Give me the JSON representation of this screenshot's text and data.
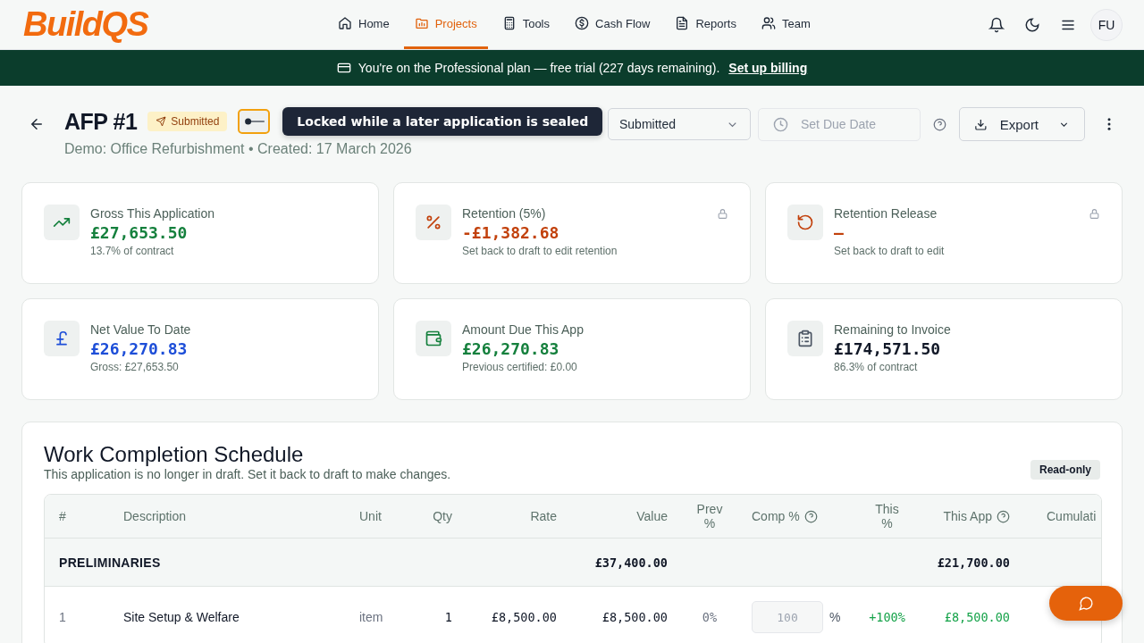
{
  "nav": {
    "logo": "BuildQS",
    "items": [
      {
        "label": "Home",
        "selected": false
      },
      {
        "label": "Projects",
        "selected": true
      },
      {
        "label": "Tools",
        "selected": false
      },
      {
        "label": "Cash Flow",
        "selected": false
      },
      {
        "label": "Reports",
        "selected": false
      },
      {
        "label": "Team",
        "selected": false
      }
    ],
    "avatar": "FU"
  },
  "banner": {
    "text": "You're on the Professional plan — free trial (227 days remaining).",
    "link": "Set up billing"
  },
  "header": {
    "title": "AFP #1",
    "status_badge": "Submitted",
    "tooltip": "Locked while a later application is sealed",
    "subtitle": "Demo: Office Refurbishment • Created: 17 March 2026",
    "status_select": "Submitted",
    "due_date": {
      "label": "Set Due Date",
      "disabled": true
    },
    "export": "Export"
  },
  "cards": [
    {
      "label": "Gross This Application",
      "value": "£27,653.50",
      "color": "#15803d",
      "note": "13.7% of contract",
      "locked": false
    },
    {
      "label": "Retention (5%)",
      "value": "-£1,382.68",
      "color": "#c2410c",
      "note": "Set back to draft to edit retention",
      "locked": true
    },
    {
      "label": "Retention Release",
      "value": "—",
      "color": "#c2410c",
      "note": "Set back to draft to edit",
      "locked": true
    },
    {
      "label": "Net Value To Date",
      "value": "£26,270.83",
      "color": "#1d4ed8",
      "note": "Gross: £27,653.50",
      "locked": false
    },
    {
      "label": "Amount Due This App",
      "value": "£26,270.83",
      "color": "#15803d",
      "note": "Previous certified: £0.00",
      "locked": false
    },
    {
      "label": "Remaining to Invoice",
      "value": "£174,571.50",
      "color": "#111827",
      "note": "86.3% of contract",
      "locked": false
    }
  ],
  "schedule": {
    "title": "Work Completion Schedule",
    "subtitle": "This application is no longer in draft. Set it back to draft to make changes.",
    "badge": "Read-only",
    "columns": [
      {
        "label": "#",
        "help": false
      },
      {
        "label": "Description",
        "help": false
      },
      {
        "label": "Unit",
        "help": false
      },
      {
        "label": "Qty",
        "help": false
      },
      {
        "label": "Rate",
        "help": false
      },
      {
        "label": "Value",
        "help": false
      },
      {
        "label": "Prev %",
        "help": false
      },
      {
        "label": "Comp %",
        "help": true
      },
      {
        "label": "This %",
        "help": false
      },
      {
        "label": "This App",
        "help": true
      },
      {
        "label": "Cumulati",
        "help": false
      }
    ],
    "rows": [
      {
        "kind": "section",
        "label": "PRELIMINARIES",
        "value": "£37,400.00",
        "this_app": "£21,700.00"
      },
      {
        "kind": "item",
        "number": "1",
        "description": "Site Setup & Welfare",
        "unit": "item",
        "qty": "1",
        "rate": "£8,500.00",
        "value": "£8,500.00",
        "prev": "0%",
        "comp": "100",
        "comp_disabled": true,
        "comp_unit": "%",
        "this_pct": "+100%",
        "this_app": "£8,500.00"
      }
    ]
  }
}
